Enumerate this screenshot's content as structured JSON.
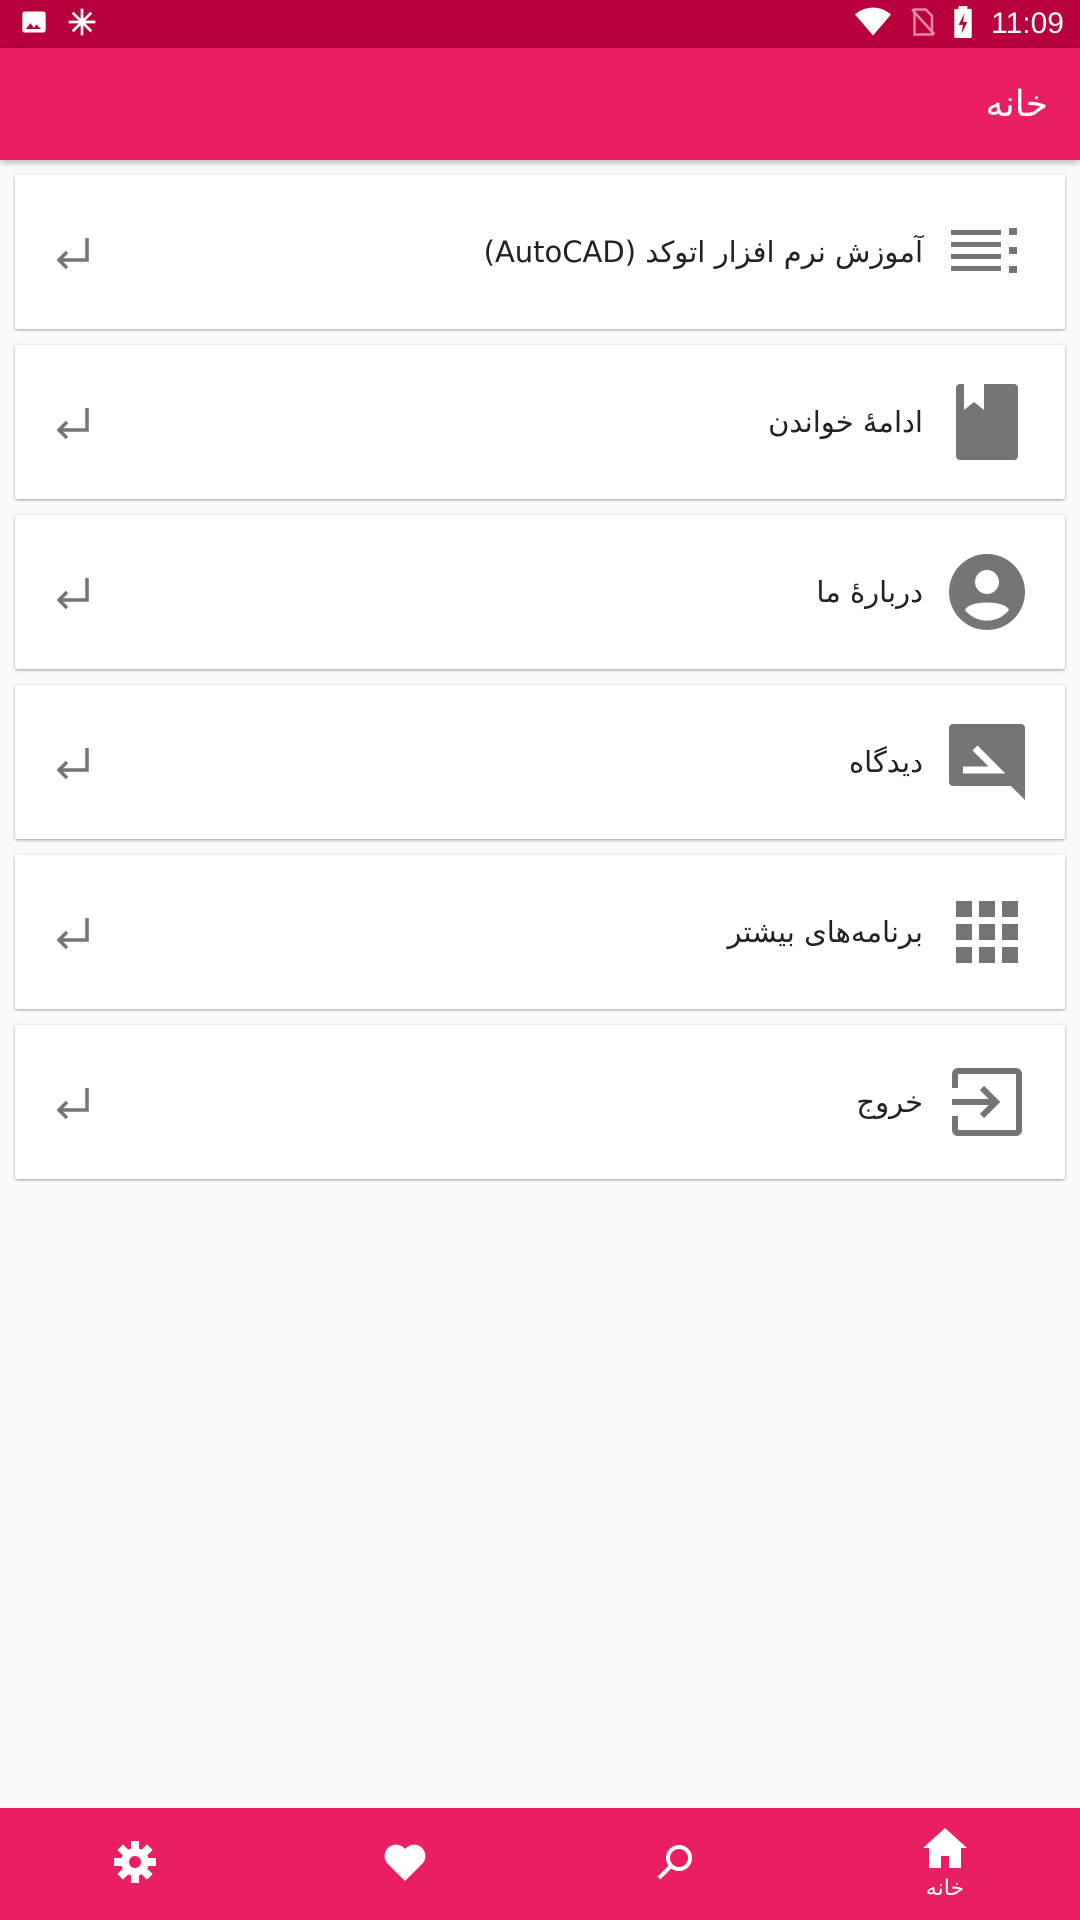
{
  "status_bar": {
    "time": "11:09",
    "left_icons": [
      "image-icon",
      "snowflake-icon"
    ],
    "right_icons": [
      "wifi-icon",
      "no-sim-icon",
      "battery-charging-icon"
    ]
  },
  "app_bar": {
    "title": "خانه"
  },
  "menu": {
    "items": [
      {
        "label": "آموزش نرم افزار اتوکد (AutoCAD)",
        "icon": "list-icon"
      },
      {
        "label": "ادامهٔ خواندن",
        "icon": "bookmark-book-icon"
      },
      {
        "label": "دربارهٔ ما",
        "icon": "account-circle-icon"
      },
      {
        "label": "دیدگاه",
        "icon": "comment-edit-icon"
      },
      {
        "label": "برنامه‌های بیشتر",
        "icon": "apps-grid-icon"
      },
      {
        "label": "خروج",
        "icon": "exit-icon"
      }
    ],
    "arrow_icon": "return-arrow-icon"
  },
  "bottom_nav": {
    "items": [
      {
        "label": "خانه",
        "icon": "home-icon",
        "active": true
      },
      {
        "label": "",
        "icon": "search-icon"
      },
      {
        "label": "",
        "icon": "heart-icon"
      },
      {
        "label": "",
        "icon": "settings-icon"
      }
    ]
  },
  "colors": {
    "status_bar": "#b8003b",
    "primary": "#e91e63",
    "icon_gray": "#757575",
    "background": "#fafafa"
  }
}
